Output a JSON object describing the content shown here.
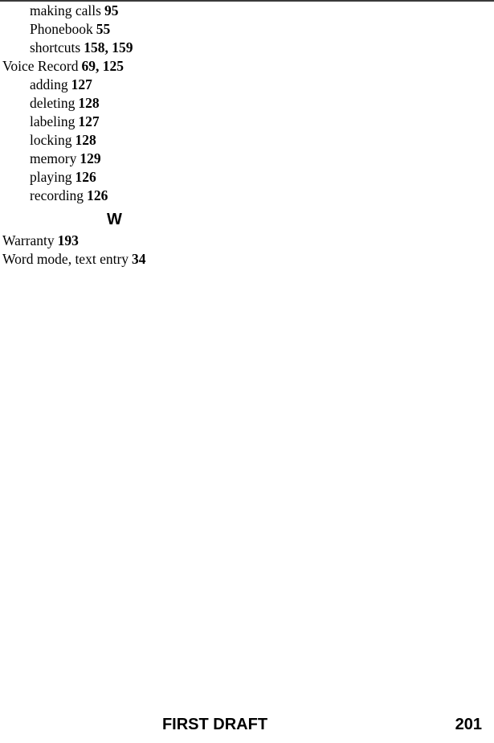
{
  "document": {
    "type": "index-page",
    "page_number": "201",
    "footer_title": "FIRST DRAFT"
  },
  "index": {
    "entries": [
      {
        "level": 1,
        "term": "making calls",
        "pages": "95"
      },
      {
        "level": 1,
        "term": "Phonebook",
        "pages": "55"
      },
      {
        "level": 1,
        "term": "shortcuts",
        "pages": "158, 159"
      },
      {
        "level": 0,
        "term": "Voice Record",
        "pages": "69, 125"
      },
      {
        "level": 1,
        "term": "adding",
        "pages": "127"
      },
      {
        "level": 1,
        "term": "deleting",
        "pages": "128"
      },
      {
        "level": 1,
        "term": "labeling",
        "pages": "127"
      },
      {
        "level": 1,
        "term": "locking",
        "pages": "128"
      },
      {
        "level": 1,
        "term": "memory",
        "pages": "129"
      },
      {
        "level": 1,
        "term": "playing",
        "pages": "126"
      },
      {
        "level": 1,
        "term": "recording",
        "pages": "126"
      }
    ],
    "letter_heading": "W",
    "entries_after_heading": [
      {
        "level": 0,
        "term": "Warranty",
        "pages": "193"
      },
      {
        "level": 0,
        "term": "Word mode, text entry",
        "pages": "34"
      }
    ]
  }
}
